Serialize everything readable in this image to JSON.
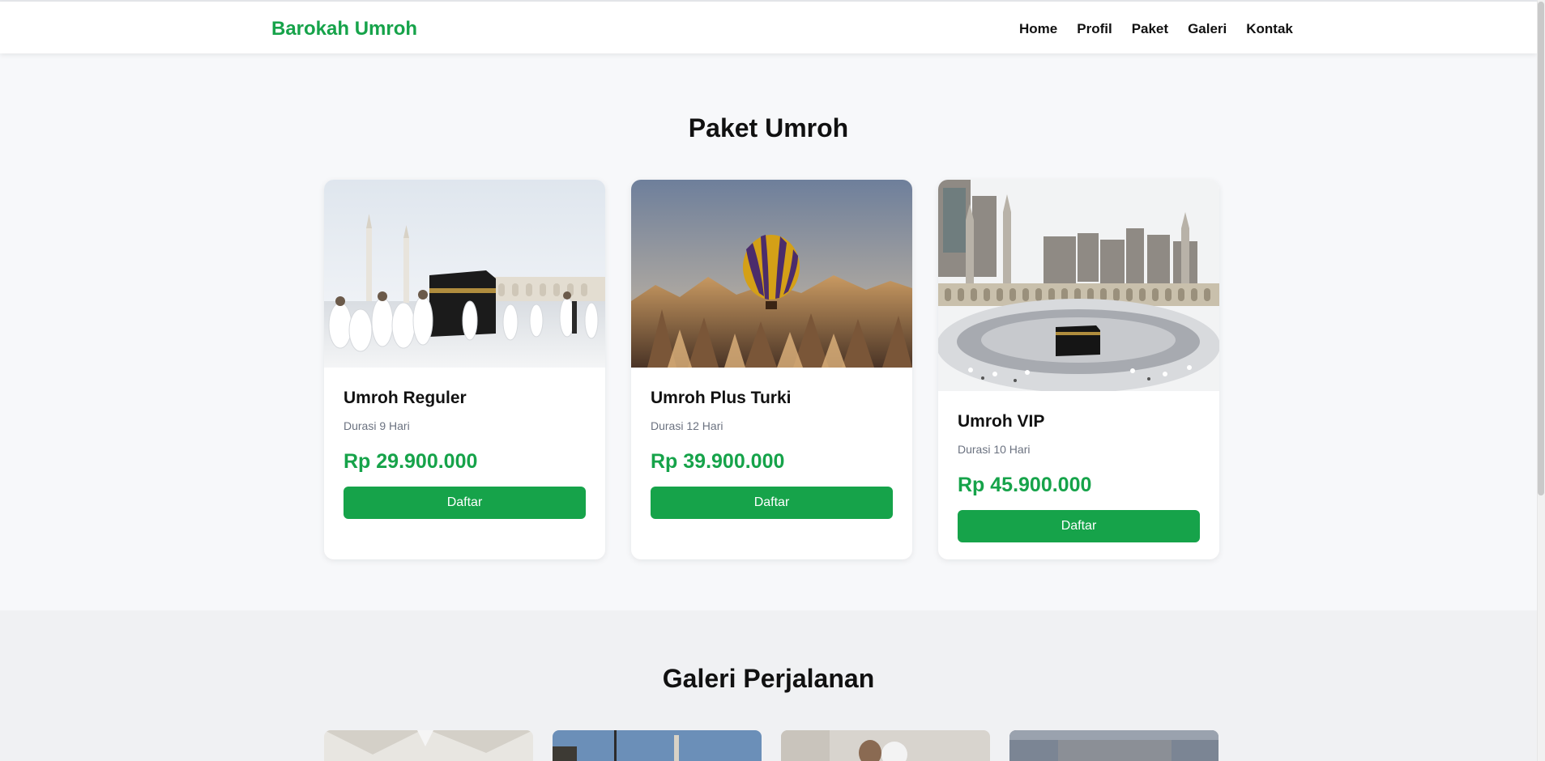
{
  "header": {
    "brand": "Barokah Umroh",
    "nav": [
      "Home",
      "Profil",
      "Paket",
      "Galeri",
      "Kontak"
    ]
  },
  "paket": {
    "title": "Paket Umroh",
    "cards": [
      {
        "name": "Umroh Reguler",
        "duration": "Durasi 9 Hari",
        "price": "Rp 29.900.000",
        "button": "Daftar",
        "image": "kaaba-pilgrims-photo"
      },
      {
        "name": "Umroh Plus Turki",
        "duration": "Durasi 12 Hari",
        "price": "Rp 39.900.000",
        "button": "Daftar",
        "image": "cappadocia-balloon-photo"
      },
      {
        "name": "Umroh VIP",
        "duration": "Durasi 10 Hari",
        "price": "Rp 45.900.000",
        "button": "Daftar",
        "image": "masjidil-haram-photo"
      }
    ]
  },
  "galeri": {
    "title": "Galeri Perjalanan",
    "thumbnails": [
      "umbrellas-photo",
      "mosque-minaret-photo",
      "pilgrims-couple-photo",
      "mosque-interior-photo"
    ]
  },
  "colors": {
    "accent": "#16a34a",
    "page_bg": "#f7f8fa",
    "gallery_bg": "#f0f1f3"
  }
}
